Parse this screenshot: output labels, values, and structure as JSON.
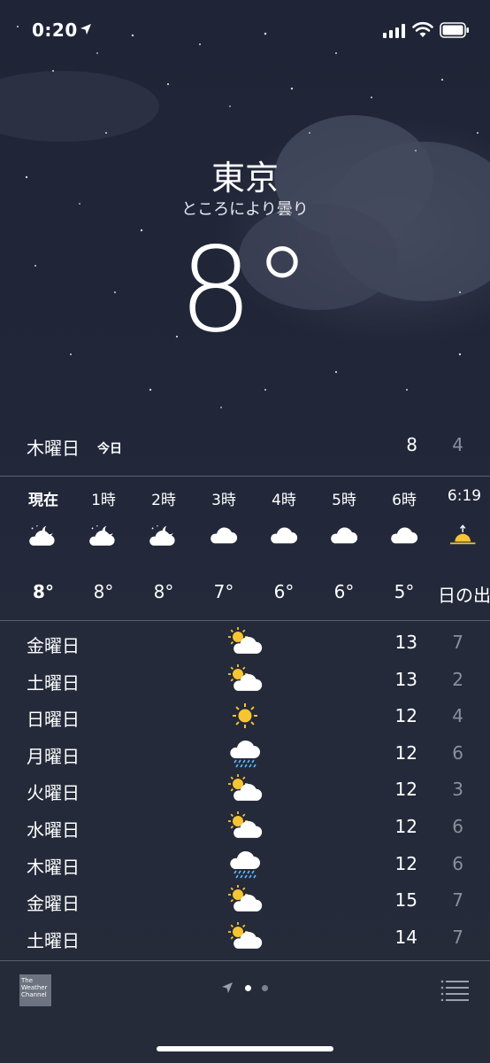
{
  "status": {
    "time": "0:20"
  },
  "location": {
    "city": "東京",
    "condition": "ところにより曇り",
    "temperature": "8°"
  },
  "today": {
    "day": "木曜日",
    "tag": "今日",
    "high": "8",
    "low": "4"
  },
  "hourly": [
    {
      "label": "現在",
      "icon": "moon-cloud-icon",
      "temp": "8°",
      "current": true
    },
    {
      "label": "1時",
      "icon": "moon-cloud-icon",
      "temp": "8°"
    },
    {
      "label": "2時",
      "icon": "moon-cloud-icon",
      "temp": "8°"
    },
    {
      "label": "3時",
      "icon": "cloud-icon",
      "temp": "7°"
    },
    {
      "label": "4時",
      "icon": "cloud-icon",
      "temp": "6°"
    },
    {
      "label": "5時",
      "icon": "cloud-icon",
      "temp": "6°"
    },
    {
      "label": "6時",
      "icon": "cloud-icon",
      "temp": "5°"
    },
    {
      "label": "6:19",
      "icon": "sunrise-icon",
      "temp": "日の出"
    }
  ],
  "daily": [
    {
      "day": "金曜日",
      "icon": "partly-sunny-icon",
      "high": "13",
      "low": "7"
    },
    {
      "day": "土曜日",
      "icon": "partly-sunny-icon",
      "high": "13",
      "low": "2"
    },
    {
      "day": "日曜日",
      "icon": "sun-icon",
      "high": "12",
      "low": "4"
    },
    {
      "day": "月曜日",
      "icon": "rain-cloud-icon",
      "high": "12",
      "low": "6"
    },
    {
      "day": "火曜日",
      "icon": "partly-sunny-icon",
      "high": "12",
      "low": "3"
    },
    {
      "day": "水曜日",
      "icon": "partly-sunny-icon",
      "high": "12",
      "low": "6"
    },
    {
      "day": "木曜日",
      "icon": "rain-cloud-icon",
      "high": "12",
      "low": "6"
    },
    {
      "day": "金曜日",
      "icon": "partly-sunny-icon",
      "high": "15",
      "low": "7"
    },
    {
      "day": "土曜日",
      "icon": "partly-sunny-icon",
      "high": "14",
      "low": "7"
    }
  ],
  "footer": {
    "provider": "The Weather Channel"
  },
  "colors": {
    "sun": "#f6c531",
    "rain": "#5ab8ff",
    "dim_text": "#8b8f9b"
  }
}
